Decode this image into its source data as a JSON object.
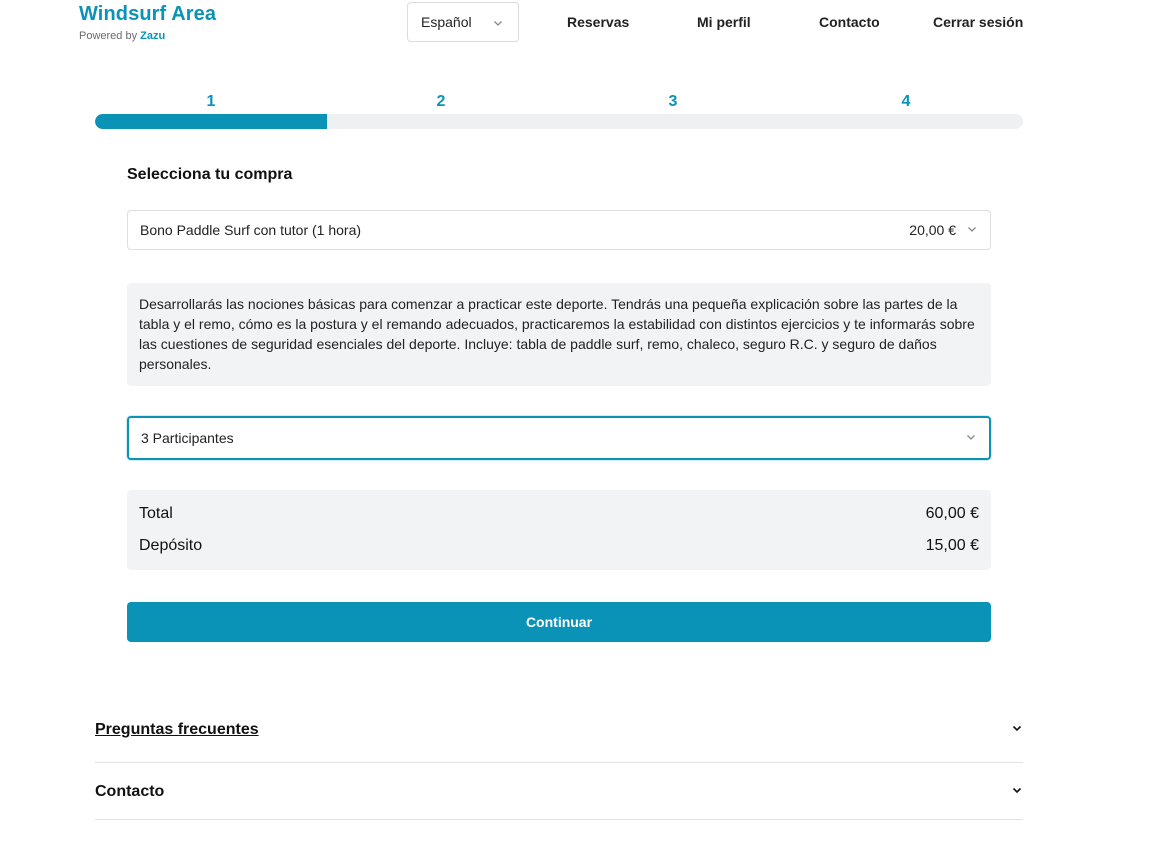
{
  "brand": {
    "title": "Windsurf Area",
    "powered_prefix": "Powered by",
    "powered_name": "Zazu"
  },
  "language": {
    "selected": "Español"
  },
  "nav": {
    "reservas": "Reservas",
    "perfil": "Mi perfil",
    "contacto": "Contacto",
    "logout": "Cerrar sesión"
  },
  "steps": {
    "labels": [
      "1",
      "2",
      "3",
      "4"
    ],
    "current": 1,
    "progress_fraction": 0.25
  },
  "purchase": {
    "section_title": "Selecciona tu compra",
    "selected_product": "Bono Paddle Surf con tutor (1 hora)",
    "price": "20,00 €",
    "description": "Desarrollarás las nociones básicas para comenzar a practicar este deporte. Tendrás una pequeña explicación sobre las partes de la tabla y el remo, cómo es la postura y el remando adecuados, practicaremos la estabilidad con distintos ejercicios y te informarás sobre las cuestiones de seguridad esenciales del deporte. Incluye: tabla de paddle surf, remo, chaleco, seguro R.C. y seguro de daños personales.",
    "participants": "3 Participantes"
  },
  "summary": {
    "total_label": "Total",
    "total_value": "60,00 €",
    "deposit_label": "Depósito",
    "deposit_value": "15,00 €"
  },
  "actions": {
    "continue": "Continuar"
  },
  "accordions": {
    "faq": "Preguntas frecuentes",
    "contact": "Contacto"
  },
  "colors": {
    "accent": "#0a93b7",
    "panel": "#f2f3f5"
  }
}
